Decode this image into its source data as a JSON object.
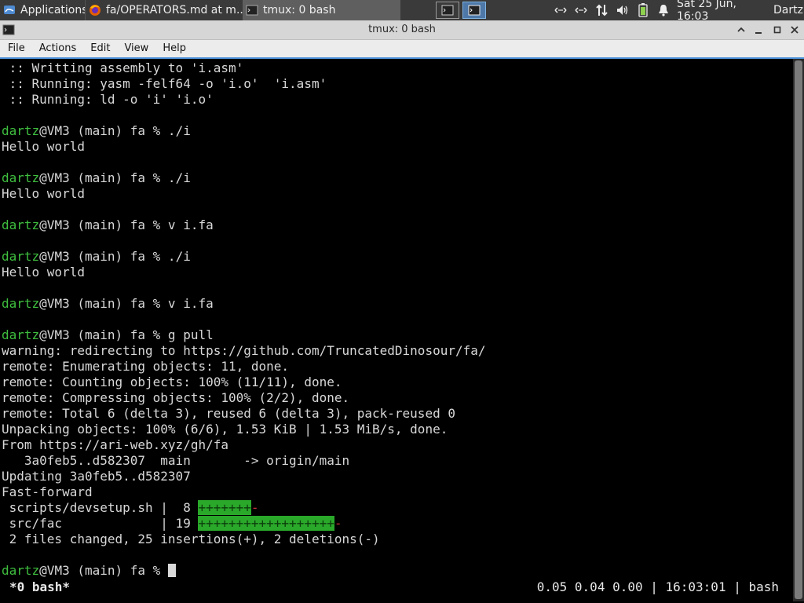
{
  "panel": {
    "applications_label": "Applications",
    "firefox_task": "fa/OPERATORS.md at m...",
    "terminal_task": "tmux: 0 bash",
    "date": "Sat 25 Jun, 16:03",
    "user": "Dartz"
  },
  "window": {
    "title": "tmux: 0 bash"
  },
  "menu": {
    "items": [
      "File",
      "Actions",
      "Edit",
      "View",
      "Help"
    ]
  },
  "terminal": {
    "lines": [
      [
        {
          "t": " :: Writting assembly to 'i.asm'"
        }
      ],
      [
        {
          "t": " :: Running: yasm -felf64 -o 'i.o'  'i.asm'"
        }
      ],
      [
        {
          "t": " :: Running: ld -o 'i' 'i.o'"
        }
      ],
      [
        {
          "t": ""
        }
      ],
      [
        {
          "t": "dartz",
          "c": "user"
        },
        {
          "t": "@VM3 (main) fa % ./i"
        }
      ],
      [
        {
          "t": "Hello world"
        }
      ],
      [
        {
          "t": ""
        }
      ],
      [
        {
          "t": "dartz",
          "c": "user"
        },
        {
          "t": "@VM3 (main) fa % ./i"
        }
      ],
      [
        {
          "t": "Hello world"
        }
      ],
      [
        {
          "t": ""
        }
      ],
      [
        {
          "t": "dartz",
          "c": "user"
        },
        {
          "t": "@VM3 (main) fa % v i.fa"
        }
      ],
      [
        {
          "t": ""
        }
      ],
      [
        {
          "t": "dartz",
          "c": "user"
        },
        {
          "t": "@VM3 (main) fa % ./i"
        }
      ],
      [
        {
          "t": "Hello world"
        }
      ],
      [
        {
          "t": ""
        }
      ],
      [
        {
          "t": "dartz",
          "c": "user"
        },
        {
          "t": "@VM3 (main) fa % v i.fa"
        }
      ],
      [
        {
          "t": ""
        }
      ],
      [
        {
          "t": "dartz",
          "c": "user"
        },
        {
          "t": "@VM3 (main) fa % g pull"
        }
      ],
      [
        {
          "t": "warning: redirecting to https://github.com/TruncatedDinosour/fa/"
        }
      ],
      [
        {
          "t": "remote: Enumerating objects: 11, done."
        }
      ],
      [
        {
          "t": "remote: Counting objects: 100% (11/11), done."
        }
      ],
      [
        {
          "t": "remote: Compressing objects: 100% (2/2), done."
        }
      ],
      [
        {
          "t": "remote: Total 6 (delta 3), reused 6 (delta 3), pack-reused 0"
        }
      ],
      [
        {
          "t": "Unpacking objects: 100% (6/6), 1.53 KiB | 1.53 MiB/s, done."
        }
      ],
      [
        {
          "t": "From https://ari-web.xyz/gh/fa"
        }
      ],
      [
        {
          "t": "   3a0feb5..d582307  main       -> origin/main"
        }
      ],
      [
        {
          "t": "Updating 3a0feb5..d582307"
        }
      ],
      [
        {
          "t": "Fast-forward"
        }
      ],
      [
        {
          "t": " scripts/devsetup.sh |  8 "
        },
        {
          "t": "+++++++",
          "c": "plus"
        },
        {
          "t": "-",
          "c": "minus"
        }
      ],
      [
        {
          "t": " src/fac             | 19 "
        },
        {
          "t": "++++++++++++++++++",
          "c": "plus"
        },
        {
          "t": "-",
          "c": "minus"
        }
      ],
      [
        {
          "t": " 2 files changed, 25 insertions(+), 2 deletions(-)"
        }
      ],
      [
        {
          "t": ""
        }
      ],
      [
        {
          "t": "dartz",
          "c": "user"
        },
        {
          "t": "@VM3 (main) fa % "
        },
        {
          "cursor": true
        }
      ]
    ]
  },
  "tmux_status": {
    "left": "*0 bash*",
    "right": "0.05 0.04 0.00 | 16:03:01 | bash"
  }
}
